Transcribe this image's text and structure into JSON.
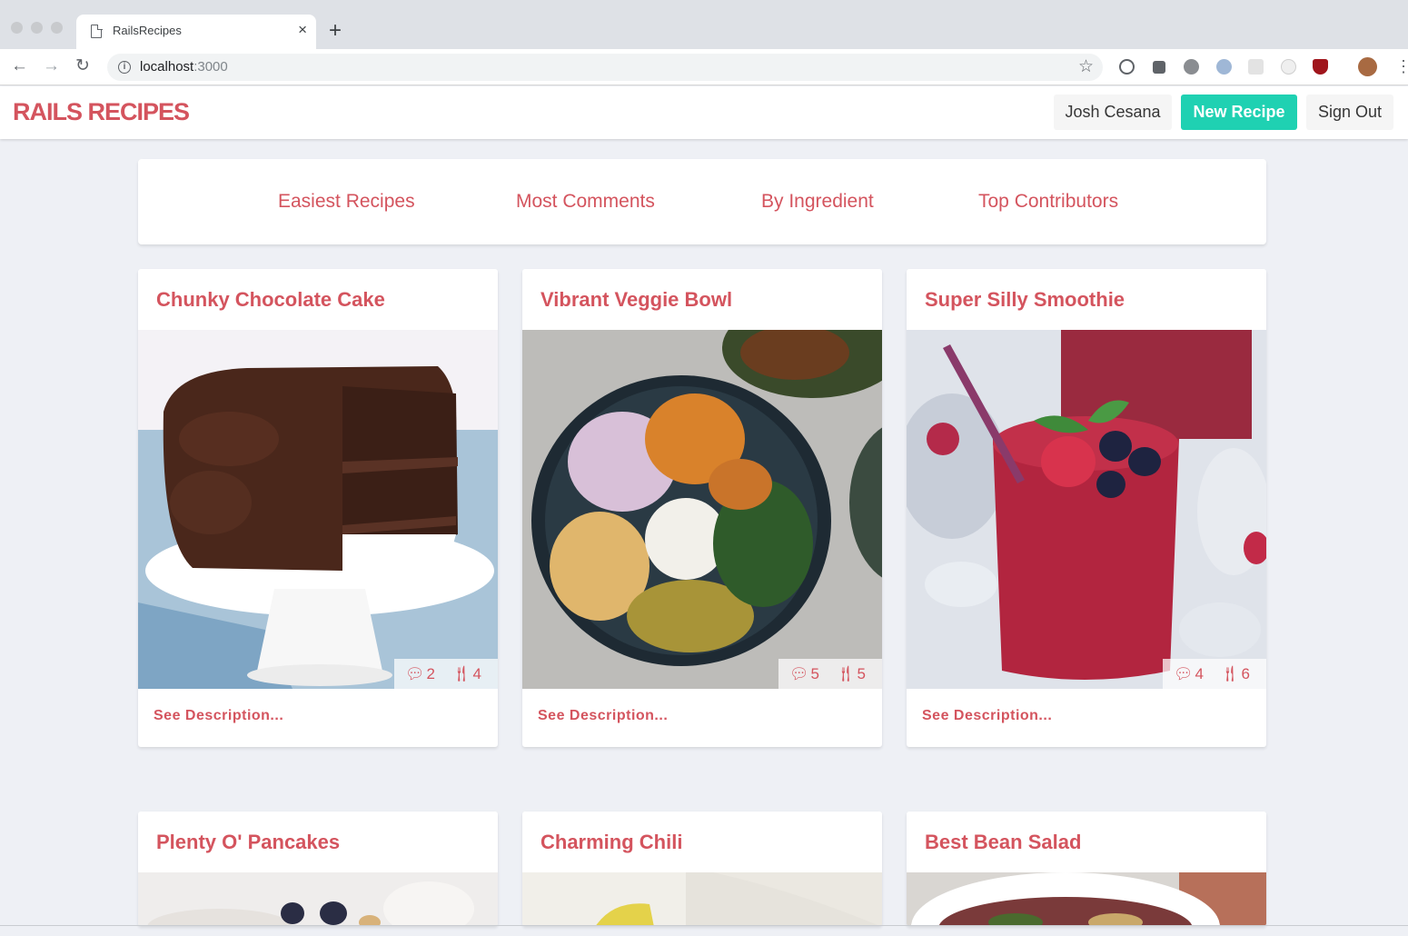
{
  "browser": {
    "tab_title": "RailsRecipes",
    "tab_close": "×",
    "new_tab": "+",
    "back": "←",
    "forward": "→",
    "reload": "↻",
    "url_host": "localhost",
    "url_port": ":3000",
    "star": "☆",
    "menu": "⋮",
    "extensions": [
      "password-extension-icon",
      "pocket-extension-icon",
      "tomato-extension-icon",
      "blue-extension-icon",
      "grid-extension-icon",
      "ghost-extension-icon",
      "ublock-extension-icon",
      "profile-avatar"
    ]
  },
  "navbar": {
    "brand": "RAILS RECIPES",
    "user_label": "Josh Cesana",
    "new_recipe_label": "New Recipe",
    "sign_out_label": "Sign Out"
  },
  "filters": [
    {
      "label": "Easiest Recipes"
    },
    {
      "label": "Most Comments"
    },
    {
      "label": "By Ingredient"
    },
    {
      "label": "Top Contributors"
    }
  ],
  "recipes": [
    {
      "title": "Chunky Chocolate Cake",
      "comments": "2",
      "ingredients": "4",
      "description_link": "See Description..."
    },
    {
      "title": "Vibrant Veggie Bowl",
      "comments": "5",
      "ingredients": "5",
      "description_link": "See Description..."
    },
    {
      "title": "Super Silly Smoothie",
      "comments": "4",
      "ingredients": "6",
      "description_link": "See Description..."
    },
    {
      "title": "Plenty O' Pancakes"
    },
    {
      "title": "Charming Chili"
    },
    {
      "title": "Best Bean Salad"
    }
  ],
  "colors": {
    "accent": "#d4545e",
    "primary_button": "#1fd1b2",
    "page_background": "#eef0f5"
  }
}
